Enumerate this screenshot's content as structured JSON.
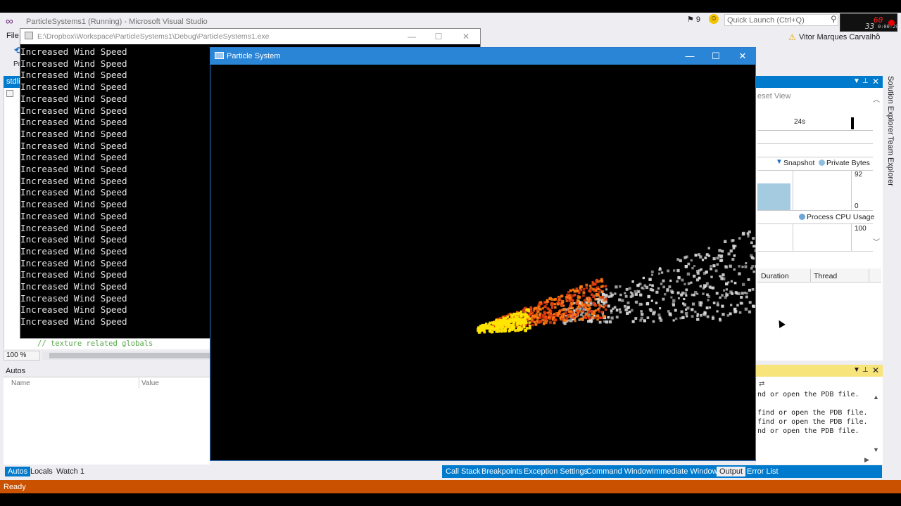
{
  "vs": {
    "title": "ParticleSystems1 (Running) - Microsoft Visual Studio",
    "notification_count": "9",
    "quick_launch_placeholder": "Quick Launch (Ctrl+Q)",
    "user_name": "Vitor Marques Carvalho",
    "fps": "60",
    "fps_secondary": "33",
    "timer": "0:00:29",
    "menu_file": "File",
    "toolbar_pr": "Pr"
  },
  "editor": {
    "tab_label": "stdlii",
    "code_comment": "// texture related globals",
    "zoom": "100 %"
  },
  "autos": {
    "title": "Autos",
    "col_name": "Name",
    "col_value": "Value"
  },
  "bottom_tabs_left": [
    "Autos",
    "Locals",
    "Watch 1"
  ],
  "bottom_tabs_right": [
    "Call Stack",
    "Breakpoints",
    "Exception Settings",
    "Command Window",
    "Immediate Window",
    "Output",
    "Error List"
  ],
  "status": {
    "text": "Ready"
  },
  "console": {
    "title": "E:\\Dropbox\\Workspace\\ParticleSystems1\\Debug\\ParticleSystems1.exe",
    "lines": [
      "Increased Wind Speed",
      "Increased Wind Speed",
      "Increased Wind Speed",
      "Increased Wind Speed",
      "Increased Wind Speed",
      "Increased Wind Speed",
      "Increased Wind Speed",
      "Increased Wind Speed",
      "Increased Wind Speed",
      "Increased Wind Speed",
      "Increased Wind Speed",
      "Increased Wind Speed",
      "Increased Wind Speed",
      "Increased Wind Speed",
      "Increased Wind Speed",
      "Increased Wind Speed",
      "Increased Wind Speed",
      "Increased Wind Speed",
      "Increased Wind Speed",
      "Increased Wind Speed",
      "Increased Wind Speed",
      "Increased Wind Speed",
      "Increased Wind Speed",
      "Increased Wind Speed"
    ]
  },
  "particle_window": {
    "title": "Particle System",
    "colors": {
      "hot": "#ffe600",
      "warm": "#ff7a10",
      "cool": "#e03a10",
      "smoke": "#d8d8d8"
    }
  },
  "diagnostics": {
    "reset_view": "eset View",
    "time_marker": "24s",
    "snapshot": "Snapshot",
    "private_bytes": "Private Bytes",
    "mem_max": "92",
    "mem_min": "0",
    "cpu_label": "Process CPU Usage",
    "cpu_max": "100",
    "col_duration": "Duration",
    "col_thread": "Thread"
  },
  "vertical_tabs": [
    "Solution Explorer",
    "Team Explorer"
  ],
  "output": {
    "lines": [
      "nd or open the PDB file.",
      "",
      "find or open the PDB file.",
      "find or open the PDB file.",
      "nd or open the PDB file."
    ]
  }
}
